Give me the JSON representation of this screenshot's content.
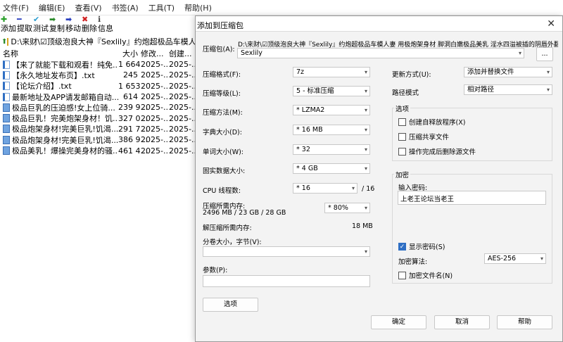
{
  "menu": [
    "文件(F)",
    "编辑(E)",
    "查看(V)",
    "书签(A)",
    "工具(T)",
    "帮助(H)"
  ],
  "toolbar": [
    {
      "label": "添加",
      "icon": "plus-icon",
      "glyph": "✚",
      "color": "#2aa02a"
    },
    {
      "label": "提取",
      "icon": "minus-icon",
      "glyph": "━",
      "color": "#2a3fbf"
    },
    {
      "label": "测试",
      "icon": "check-icon",
      "glyph": "✔",
      "color": "#2a9ccf"
    },
    {
      "label": "复制",
      "icon": "copy-arrow-icon",
      "glyph": "➡",
      "color": "#2a8a2a"
    },
    {
      "label": "移动",
      "icon": "move-arrow-icon",
      "glyph": "➡",
      "color": "#2a3fbf"
    },
    {
      "label": "删除",
      "icon": "delete-icon",
      "glyph": "✖",
      "color": "#d02020"
    },
    {
      "label": "信息",
      "icon": "info-icon",
      "glyph": "ℹ",
      "color": "#444444"
    }
  ],
  "address": {
    "path": "D:\\来财\\☑顶级泡良大神『Sexlily』约炮超极品车模人妻"
  },
  "columns": {
    "name": "名称",
    "size": "大小",
    "modified": "修改...",
    "created": "创建..."
  },
  "files": [
    {
      "name": "【来了就能下载和观看！纯免...",
      "size": "1 664",
      "modified": "2025-...",
      "created": "2025-...",
      "type": "txt"
    },
    {
      "name": "【永久地址发布页】.txt",
      "size": "245",
      "modified": "2025-...",
      "created": "2025-...",
      "type": "txt"
    },
    {
      "name": "【论坛介绍】.txt",
      "size": "1 653",
      "modified": "2025-...",
      "created": "2025-...",
      "type": "txt"
    },
    {
      "name": "最新地址及APP请发邮箱自动...",
      "size": "614",
      "modified": "2025-...",
      "created": "2025-...",
      "type": "txt"
    },
    {
      "name": "极品巨乳的压迫感!女上位骑...",
      "size": "239 9...",
      "modified": "2025-...",
      "created": "2025-...",
      "type": "img"
    },
    {
      "name": "极品巨乳！完美炮架身材！饥...",
      "size": "327 0...",
      "modified": "2025-...",
      "created": "2025-...",
      "type": "img"
    },
    {
      "name": "极品炮架身材!完美巨乳!饥渴...",
      "size": "291 7...",
      "modified": "2025-...",
      "created": "2025-...",
      "type": "img"
    },
    {
      "name": "极品炮架身材!完美巨乳!饥渴...",
      "size": "386 9...",
      "modified": "2025-...",
      "created": "2025-...",
      "type": "img"
    },
    {
      "name": "极品美乳！爆操完美身材的骚...",
      "size": "461 4...",
      "modified": "2025-...",
      "created": "2025-...",
      "type": "img"
    }
  ],
  "dialog": {
    "title": "添加到压缩包",
    "archive_label": "压缩包(A):",
    "archive_path": "D:\\来财\\☑顶级泡良大神『Sexlily』约炮超极品车模人妻 用极炮架身材 脚洞白嫩极品美乳 淫水四溢被插的阴唇外翻",
    "archive_name": "Sexlily",
    "browse_label": "...",
    "format_label": "压缩格式(F):",
    "format_value": "7z",
    "level_label": "压缩等级(L):",
    "level_value": "5 - 标准压缩",
    "method_label": "压缩方法(M):",
    "method_value": "*  LZMA2",
    "dict_label": "字典大小(D):",
    "dict_value": "*  16 MB",
    "word_label": "单词大小(W):",
    "word_value": "*  32",
    "solid_label": "固实数据大小:",
    "solid_value": "*  4 GB",
    "cpu_label": "CPU 线程数:",
    "cpu_value": "*  16",
    "cpu_total": "/ 16",
    "mem_label": "压缩所需内存:",
    "mem_value": "2496 MB / 23 GB / 28 GB",
    "mem_pct": "* 80%",
    "demem_label": "解压缩所需内存:",
    "demem_value": "18 MB",
    "split_label": "分卷大小，字节(V):",
    "split_value": "",
    "params_label": "参数(P):",
    "params_value": "",
    "options_button": "选项",
    "update_label": "更新方式(U):",
    "update_value": "添加并替换文件",
    "pathmode_label": "路径模式",
    "pathmode_value": "相对路径",
    "options_group": "选项",
    "opt_sfx": "创建自释放程序(X)",
    "opt_shared": "压缩共享文件",
    "opt_delete": "操作完成后删除源文件",
    "enc_group": "加密",
    "pwd_label": "输入密码:",
    "pwd_value": "上老王论坛当老王",
    "show_pwd": "显示密码(S)",
    "enc_method_label": "加密算法:",
    "enc_method_value": "AES-256",
    "enc_names": "加密文件名(N)",
    "ok": "确定",
    "cancel": "取消",
    "help": "帮助"
  }
}
